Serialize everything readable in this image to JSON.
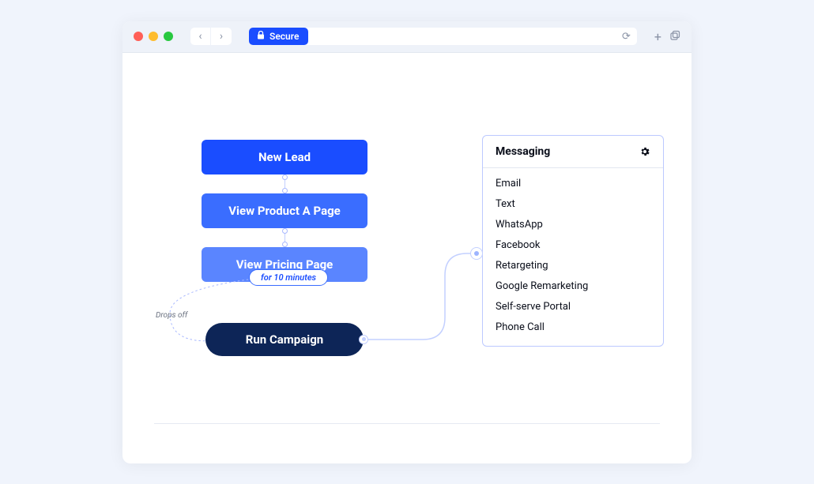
{
  "browser": {
    "secure_label": "Secure"
  },
  "flow": {
    "nodes": [
      {
        "label": "New Lead"
      },
      {
        "label": "View Product A Page"
      },
      {
        "label": "View Pricing Page"
      }
    ],
    "duration_label": "for 10 minutes",
    "action_label": "Run Campaign",
    "dropoff_label": "Drops off"
  },
  "panel": {
    "title": "Messaging",
    "items": [
      "Email",
      "Text",
      "WhatsApp",
      "Facebook",
      "Retargeting",
      "Google Remarketing",
      "Self-serve Portal",
      "Phone Call"
    ]
  }
}
